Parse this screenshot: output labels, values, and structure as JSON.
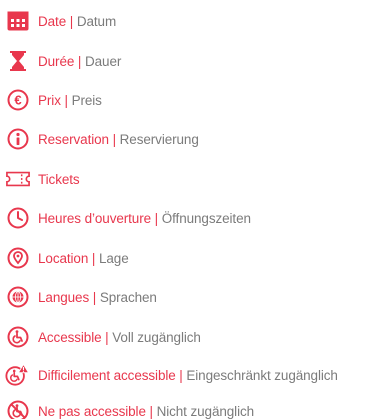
{
  "colors": {
    "accent": "#e8374d",
    "secondary_text": "#7b7b7b"
  },
  "separator": " | ",
  "items": [
    {
      "icon": "calendar-icon",
      "fr": "Date",
      "de": "Datum"
    },
    {
      "icon": "hourglass-icon",
      "fr": "Durée",
      "de": "Dauer"
    },
    {
      "icon": "euro-icon",
      "fr": "Prix",
      "de": "Preis"
    },
    {
      "icon": "info-icon",
      "fr": "Reservation",
      "de": "Reservierung"
    },
    {
      "icon": "ticket-icon",
      "fr": "Tickets",
      "de": ""
    },
    {
      "icon": "clock-icon",
      "fr": "Heures d’ouverture",
      "de": "Öffnungszeiten"
    },
    {
      "icon": "location-pin-icon",
      "fr": "Location",
      "de": "Lage"
    },
    {
      "icon": "globe-icon",
      "fr": "Langues",
      "de": "Sprachen"
    },
    {
      "icon": "wheelchair-icon",
      "fr": "Accessible",
      "de": "Voll zugänglich"
    },
    {
      "icon": "wheelchair-warning-icon",
      "fr": "Difficilement accessible",
      "de": "Eingeschränkt zugänglich"
    },
    {
      "icon": "wheelchair-crossed-icon",
      "fr": "Ne pas accessible",
      "de": "Nicht zugänglich"
    }
  ]
}
